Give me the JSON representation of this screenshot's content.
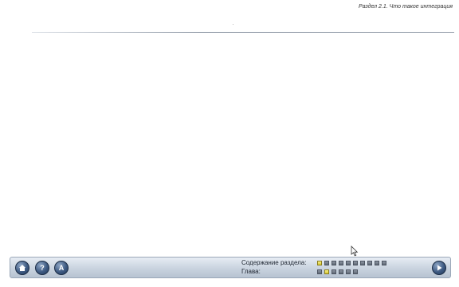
{
  "header": {
    "section_title": "Раздел 2.1. Что такое интеграция"
  },
  "bottom_bar": {
    "buttons": {
      "home_icon": "home-icon",
      "help_icon": "help-icon",
      "a_label": "A",
      "next_icon": "play-icon"
    },
    "section_contents": {
      "label": "Содержание раздела:",
      "total": 10,
      "active_index": 0
    },
    "chapter": {
      "label": "Глава:",
      "total": 6,
      "active_index": 1
    }
  },
  "colors": {
    "bar": "#c9d3df",
    "button": "#3e5a82",
    "active_square": "#e8dc4a",
    "inactive_square": "#6f7884"
  }
}
